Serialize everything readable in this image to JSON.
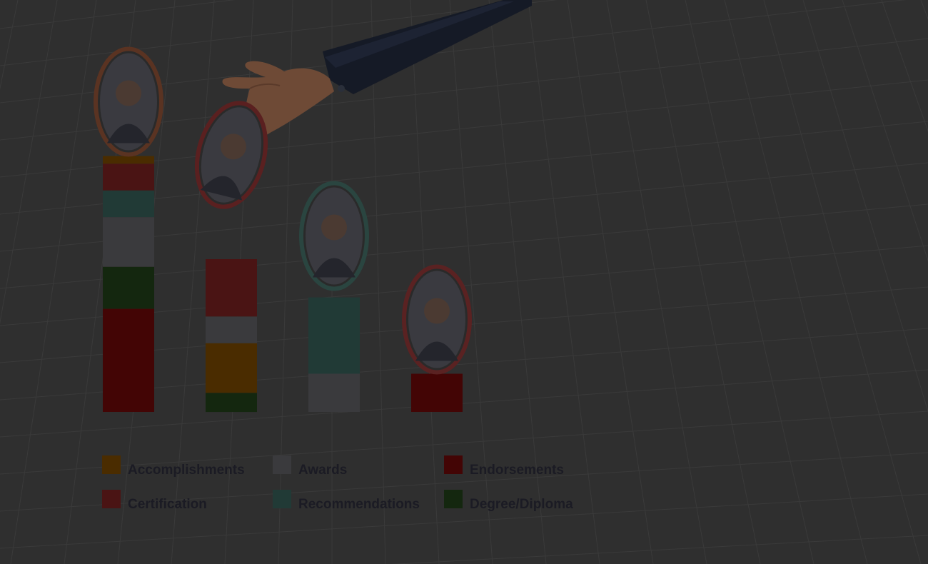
{
  "chart_data": {
    "type": "bar",
    "stacked": true,
    "series": [
      {
        "name": "Accomplishments",
        "color": "#4a2c00",
        "values": [
          2,
          0,
          0,
          0
        ]
      },
      {
        "name": "Awards",
        "color": "#3a3a3d",
        "values": [
          0,
          6,
          0,
          0
        ]
      },
      {
        "name": "Endorsements",
        "color": "#430505",
        "values": [
          0,
          0,
          0,
          0
        ]
      },
      {
        "name": "Certification",
        "color": "#4a1414",
        "values": [
          0,
          0,
          0,
          0
        ]
      },
      {
        "name": "Recommendations",
        "color": "#213a36",
        "values": [
          0,
          0,
          0,
          0
        ]
      },
      {
        "name": "Degree/Diploma",
        "color": "#14270f",
        "values": [
          0,
          0,
          0,
          0
        ]
      }
    ],
    "bars": [
      {
        "person": "candidate-1",
        "ring_color": "#5a3322",
        "segments": [
          {
            "series": "Endorsements",
            "value": 27
          },
          {
            "series": "Degree/Diploma",
            "value": 11
          },
          {
            "series": "Awards",
            "value": 13
          },
          {
            "series": "Recommendations",
            "value": 7
          },
          {
            "series": "Certification",
            "value": 7
          },
          {
            "series": "Accomplishments",
            "value": 2
          }
        ]
      },
      {
        "person": "candidate-2",
        "ring_color": "#5a2020",
        "segments": [
          {
            "series": "Degree/Diploma",
            "value": 5
          },
          {
            "series": "Accomplishments",
            "value": 13
          },
          {
            "series": "Awards",
            "value": 7
          },
          {
            "series": "Certification",
            "value": 15
          }
        ]
      },
      {
        "person": "candidate-3",
        "ring_color": "#2a4540",
        "segments": [
          {
            "series": "Awards",
            "value": 10
          },
          {
            "series": "Recommendations",
            "value": 20
          }
        ]
      },
      {
        "person": "candidate-4",
        "ring_color": "#5a2222",
        "segments": [
          {
            "series": "Endorsements",
            "value": 10
          }
        ]
      }
    ],
    "legend_position": "bottom",
    "grid": false,
    "title": "",
    "xlabel": "",
    "ylabel": ""
  },
  "legend": {
    "items": [
      {
        "label": "Accomplishments",
        "color": "#4a2c00"
      },
      {
        "label": "Awards",
        "color": "#3a3a3d"
      },
      {
        "label": "Endorsements",
        "color": "#430505"
      },
      {
        "label": "Certification",
        "color": "#4a1414"
      },
      {
        "label": "Recommendations",
        "color": "#213a36"
      },
      {
        "label": "Degree/Diploma",
        "color": "#14270f"
      }
    ]
  },
  "colors": {
    "background": "#2f2f2f",
    "grid_line": "#3a3a3a",
    "sleeve": "#151a26",
    "skin": "#6e4a36"
  },
  "icons": [
    "hand-icon",
    "avatar-icon"
  ]
}
